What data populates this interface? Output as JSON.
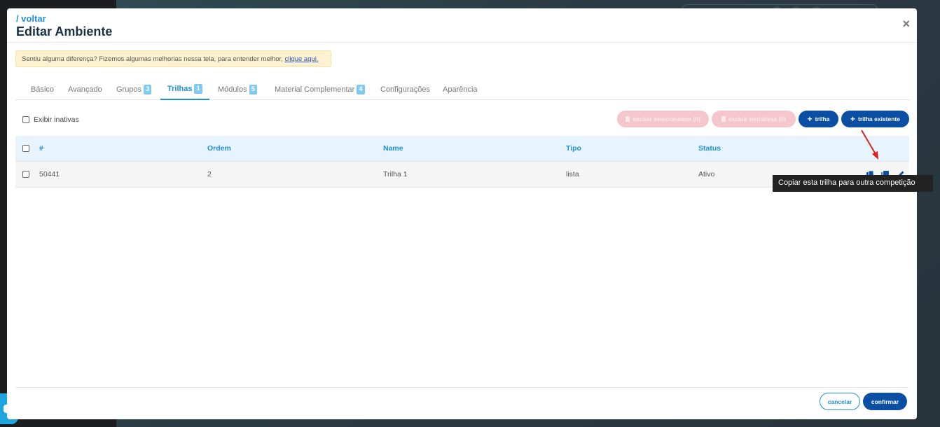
{
  "modal": {
    "back_label": "/ voltar",
    "title": "Editar Ambiente",
    "close_glyph": "×"
  },
  "notice": {
    "text": "Sentiu alguma diferença? Fizemos algumas melhorias nessa tela, para entender melhor, ",
    "link": "clique aqui."
  },
  "tabs": [
    {
      "label": "Básico",
      "badge": ""
    },
    {
      "label": "Avançado",
      "badge": ""
    },
    {
      "label": "Grupos",
      "badge": "3"
    },
    {
      "label": "Trilhas",
      "badge": "1",
      "active": true
    },
    {
      "label": "Módulos",
      "badge": "5"
    },
    {
      "label": "Material Complementar",
      "badge": "4"
    },
    {
      "label": "Configurações",
      "badge": ""
    },
    {
      "label": "Aparência",
      "badge": ""
    }
  ],
  "toolbar": {
    "show_inactive": "Exibir inativas",
    "delete_selected": "excluir selecionados (0)",
    "delete_attempts": "excluir tentativas (0)",
    "add_trail": "trilha",
    "existing_trail": "trilha existente"
  },
  "table": {
    "headers": [
      "#",
      "Ordem",
      "Name",
      "Tipo",
      "Status"
    ],
    "rows": [
      {
        "id": "50441",
        "ordem": "2",
        "name": "Trilha 1",
        "tipo": "lista",
        "status": "Ativo"
      }
    ]
  },
  "tooltip": "Copiar esta trilha para outra competição",
  "footer": {
    "cancel": "cancelar",
    "confirm": "confirmar"
  },
  "colors": {
    "accent": "#1f8fd6",
    "primary_button": "#0b4fa4",
    "annotation_arrow": "#e01f1f"
  }
}
